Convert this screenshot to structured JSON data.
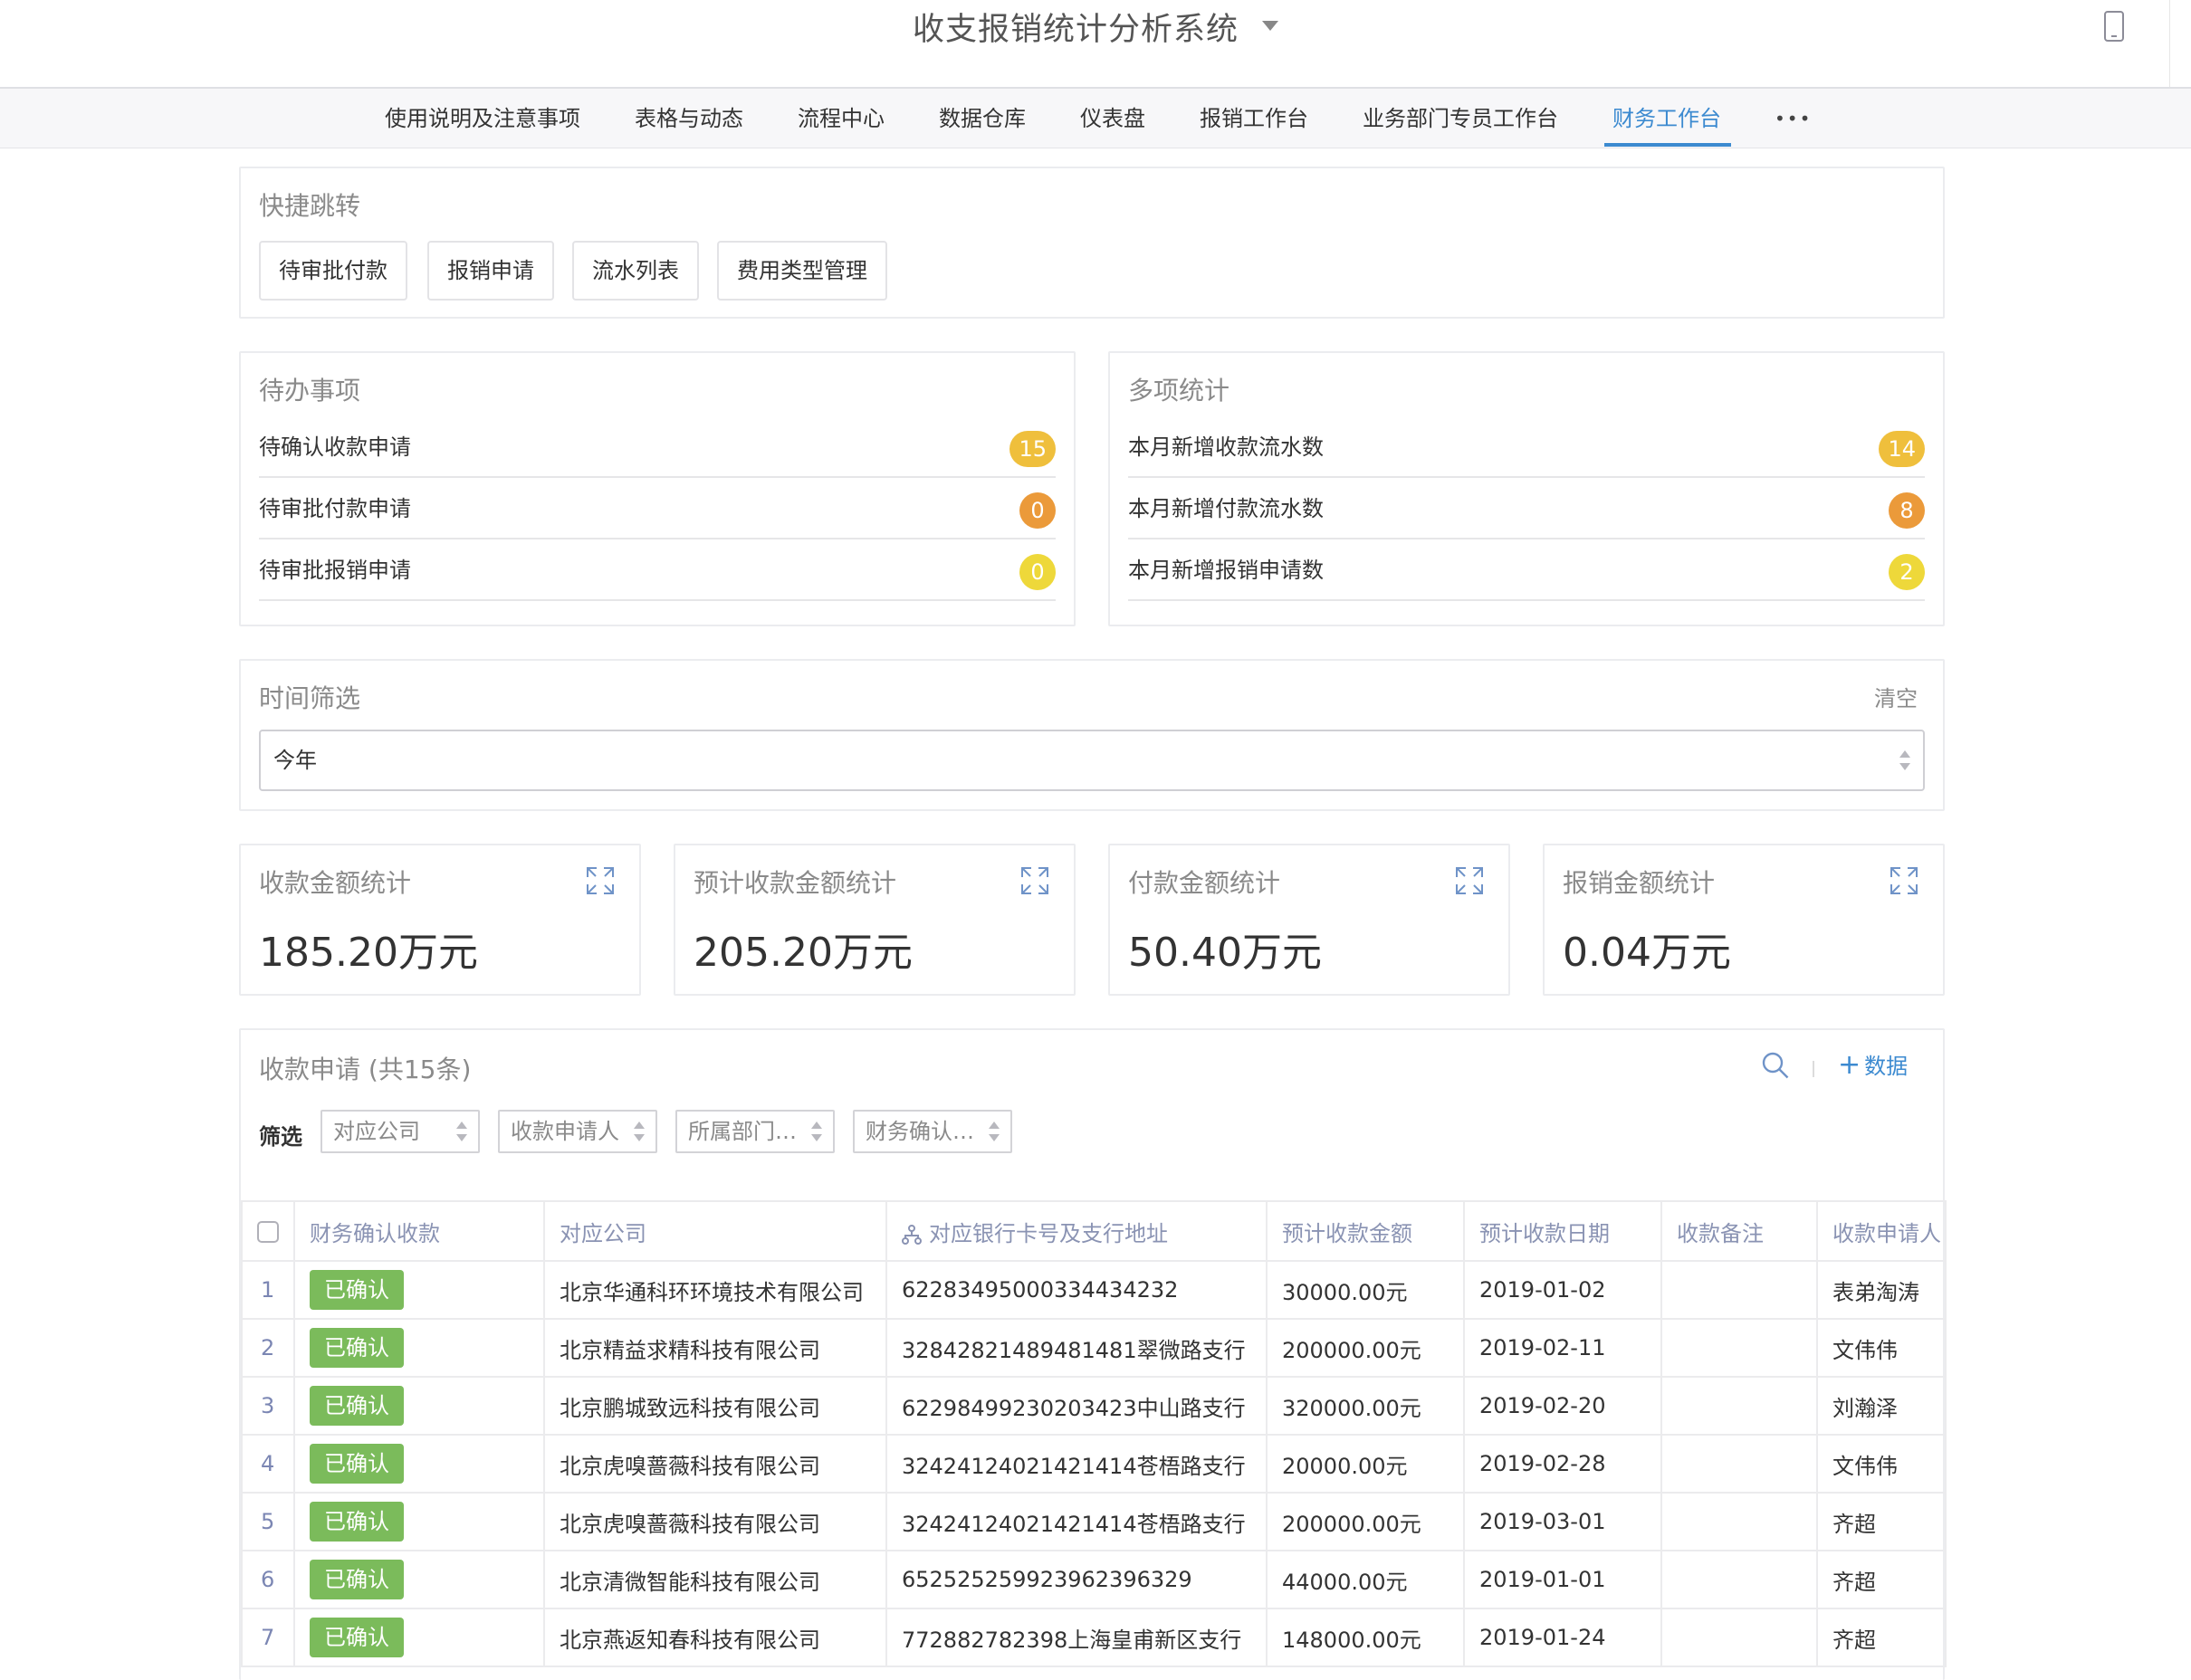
{
  "app": {
    "title": "收支报销统计分析系统"
  },
  "nav": {
    "items": [
      "使用说明及注意事项",
      "表格与动态",
      "流程中心",
      "数据仓库",
      "仪表盘",
      "报销工作台",
      "业务部门专员工作台",
      "财务工作台"
    ],
    "active": "财务工作台",
    "more": "•••"
  },
  "quick": {
    "title": "快捷跳转",
    "buttons": [
      "待审批付款",
      "报销申请",
      "流水列表",
      "费用类型管理"
    ]
  },
  "todo": {
    "title": "待办事项",
    "items": [
      {
        "label": "待确认收款申请",
        "count": "15"
      },
      {
        "label": "待审批付款申请",
        "count": "0"
      },
      {
        "label": "待审批报销申请",
        "count": "0"
      }
    ]
  },
  "multi": {
    "title": "多项统计",
    "items": [
      {
        "label": "本月新增收款流水数",
        "count": "14"
      },
      {
        "label": "本月新增付款流水数",
        "count": "8"
      },
      {
        "label": "本月新增报销申请数",
        "count": "2"
      }
    ]
  },
  "badge_colors": [
    "#efbf3c",
    "#eb9a3a",
    "#eed83a"
  ],
  "time_filter": {
    "title": "时间筛选",
    "clear": "清空",
    "value": "今年"
  },
  "stats": [
    {
      "title": "收款金额统计",
      "value": "185.20万元"
    },
    {
      "title": "预计收款金额统计",
      "value": "205.20万元"
    },
    {
      "title": "付款金额统计",
      "value": "50.40万元"
    },
    {
      "title": "报销金额统计",
      "value": "0.04万元"
    }
  ],
  "receipts": {
    "title": "收款申请 (共15条)",
    "add_label": "数据",
    "filter_label": "筛选",
    "filters": [
      "对应公司",
      "收款申请人",
      "所属部门…",
      "财务确认…"
    ],
    "columns": [
      "财务确认收款",
      "对应公司",
      "对应银行卡号及支行地址",
      "预计收款金额",
      "预计收款日期",
      "收款备注",
      "收款申请人"
    ],
    "rows": [
      {
        "no": "1",
        "status": "已确认",
        "company": "北京华通科环环境技术有限公司",
        "bank": "6228349500033443423​2",
        "amount": "30000.00元",
        "date": "2019-01-02",
        "note": "",
        "applicant": "表弟淘涛"
      },
      {
        "no": "2",
        "status": "已确认",
        "company": "北京精益求精科技有限公司",
        "bank": "32842821489481481翠微路支行",
        "amount": "200000.00元",
        "date": "2019-02-11",
        "note": "",
        "applicant": "文伟伟"
      },
      {
        "no": "3",
        "status": "已确认",
        "company": "北京鹏城致远科技有限公司",
        "bank": "62298499230203423中山路支行",
        "amount": "320000.00元",
        "date": "2019-02-20",
        "note": "",
        "applicant": "刘瀚泽"
      },
      {
        "no": "4",
        "status": "已确认",
        "company": "北京虎嗅蔷薇科技有限公司",
        "bank": "32424124021421414苍梧路支行",
        "amount": "20000.00元",
        "date": "2019-02-28",
        "note": "",
        "applicant": "文伟伟"
      },
      {
        "no": "5",
        "status": "已确认",
        "company": "北京虎嗅蔷薇科技有限公司",
        "bank": "32424124021421414苍梧路支行",
        "amount": "200000.00元",
        "date": "2019-03-01",
        "note": "",
        "applicant": "齐超"
      },
      {
        "no": "6",
        "status": "已确认",
        "company": "北京清微智能科技有限公司",
        "bank": "65252525992396239​6329",
        "amount": "44000.00元",
        "date": "2019-01-01",
        "note": "",
        "applicant": "齐超"
      },
      {
        "no": "7",
        "status": "已确认",
        "company": "北京燕返知春科技有限公司",
        "bank": "772882782398上海皇甫新区支行",
        "amount": "148000.00元",
        "date": "2019-01-24",
        "note": "",
        "applicant": "齐超"
      }
    ]
  },
  "accent_color": "#3c8ad0",
  "tag_color": "#7bbb5b"
}
